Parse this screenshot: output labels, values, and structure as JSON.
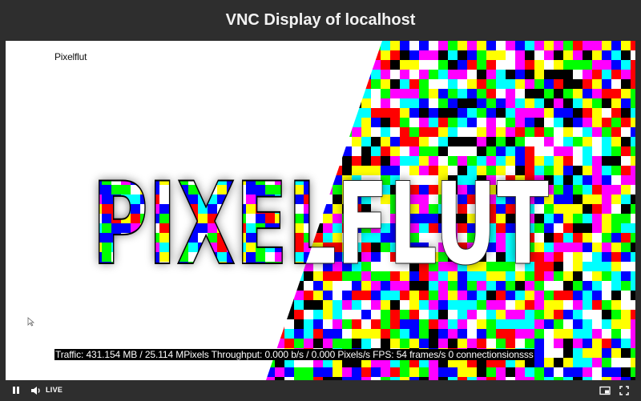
{
  "window": {
    "title": "VNC Display of localhost"
  },
  "display": {
    "label": "Pixelflut",
    "status": "Traffic: 431.154 MB / 25.114 MPixels Throughput: 0.000 b/s / 0.000 Pixels/s FPS: 54 frames/s 0 connectionsionsss",
    "banner_text": "PIXELFLUT"
  },
  "controls": {
    "live_label": "LIVE",
    "pause_icon": "pause-icon",
    "volume_icon": "volume-icon",
    "pip_icon": "picture-in-picture-icon",
    "fullscreen_icon": "fullscreen-icon"
  },
  "colors": {
    "palette": [
      "#ff0000",
      "#00ff00",
      "#0000ff",
      "#ffff00",
      "#ff00ff",
      "#00ffff",
      "#ffffff",
      "#000000"
    ]
  }
}
